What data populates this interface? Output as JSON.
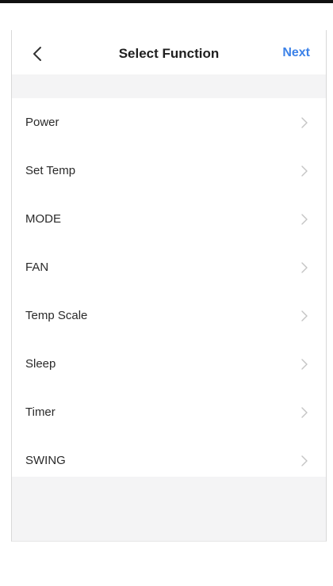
{
  "header": {
    "title": "Select Function",
    "back_icon": "chevron-left-icon",
    "next_label": "Next",
    "accent_color": "#3c82e8"
  },
  "functions": [
    {
      "label": "Power",
      "icon": "chevron-right-icon"
    },
    {
      "label": "Set Temp",
      "icon": "chevron-right-icon"
    },
    {
      "label": "MODE",
      "icon": "chevron-right-icon"
    },
    {
      "label": "FAN",
      "icon": "chevron-right-icon"
    },
    {
      "label": "Temp Scale",
      "icon": "chevron-right-icon"
    },
    {
      "label": "Sleep",
      "icon": "chevron-right-icon"
    },
    {
      "label": "Timer",
      "icon": "chevron-right-icon"
    },
    {
      "label": "SWING",
      "icon": "chevron-right-icon"
    }
  ]
}
